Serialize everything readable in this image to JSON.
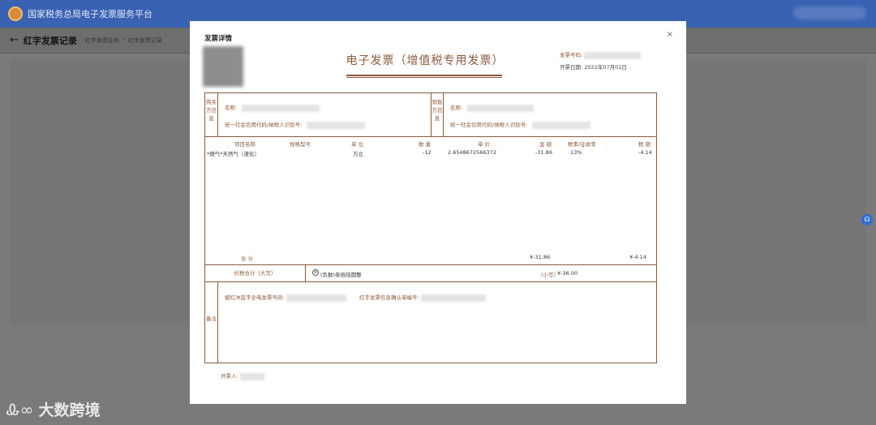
{
  "app": {
    "title": "国家税务总局电子发票服务平台"
  },
  "subheader": {
    "back_icon": "arrow-left-icon",
    "page_title": "红字发票记录",
    "breadcrumb": [
      "红字发票业务",
      "›",
      "红字发票记录"
    ]
  },
  "modal": {
    "title": "发票详情",
    "close": "×",
    "invoice_title": "电子发票（增值税专用发票）",
    "invoice_no_label": "发票号码:",
    "issue_date_label": "开票日期:",
    "issue_date": "2022年07月01日",
    "buyer_side": "购买方信息",
    "seller_side": "销售方信息",
    "buyer_name_label": "名称:",
    "buyer_tax_label": "统一社会信用代码/纳税人识别号:",
    "seller_name_label": "名称:",
    "seller_tax_label": "统一社会信用代码/纳税人识别号:",
    "columns": {
      "item": "项目名称",
      "spec": "规格型号",
      "unit": "单 位",
      "qty": "数 量",
      "price": "单 价",
      "amount": "金 额",
      "rate": "税率/征收率",
      "tax": "税 额"
    },
    "item_row": {
      "item": "*燃气*天然气（液化）",
      "unit": "万立",
      "qty": "-12",
      "price": "2.6548672566372",
      "amount": "-31.86",
      "rate": "13%",
      "tax": "-4.14"
    },
    "total_label": "合 计",
    "total_amount": "¥-31.86",
    "total_tax": "¥-4.14",
    "sum_label": "价税合计（大写）",
    "sum_upper": "(负数)叁拾陆圆整",
    "sum_lower_label": "（小写）",
    "sum_lower": "¥-36.00",
    "remark_side": "备注",
    "remark_1": "被红冲蓝字全电发票号码:",
    "remark_2": "红字发票信息确认单编号:",
    "issuer_label": "开票人:"
  },
  "watermark": {
    "mark": "Ꮂ∞",
    "text": "大数跨境"
  },
  "colors": {
    "topbar": "#3a62b3",
    "invoice_brown": "#8b5a3c",
    "overlay": "#7a7a7a"
  }
}
